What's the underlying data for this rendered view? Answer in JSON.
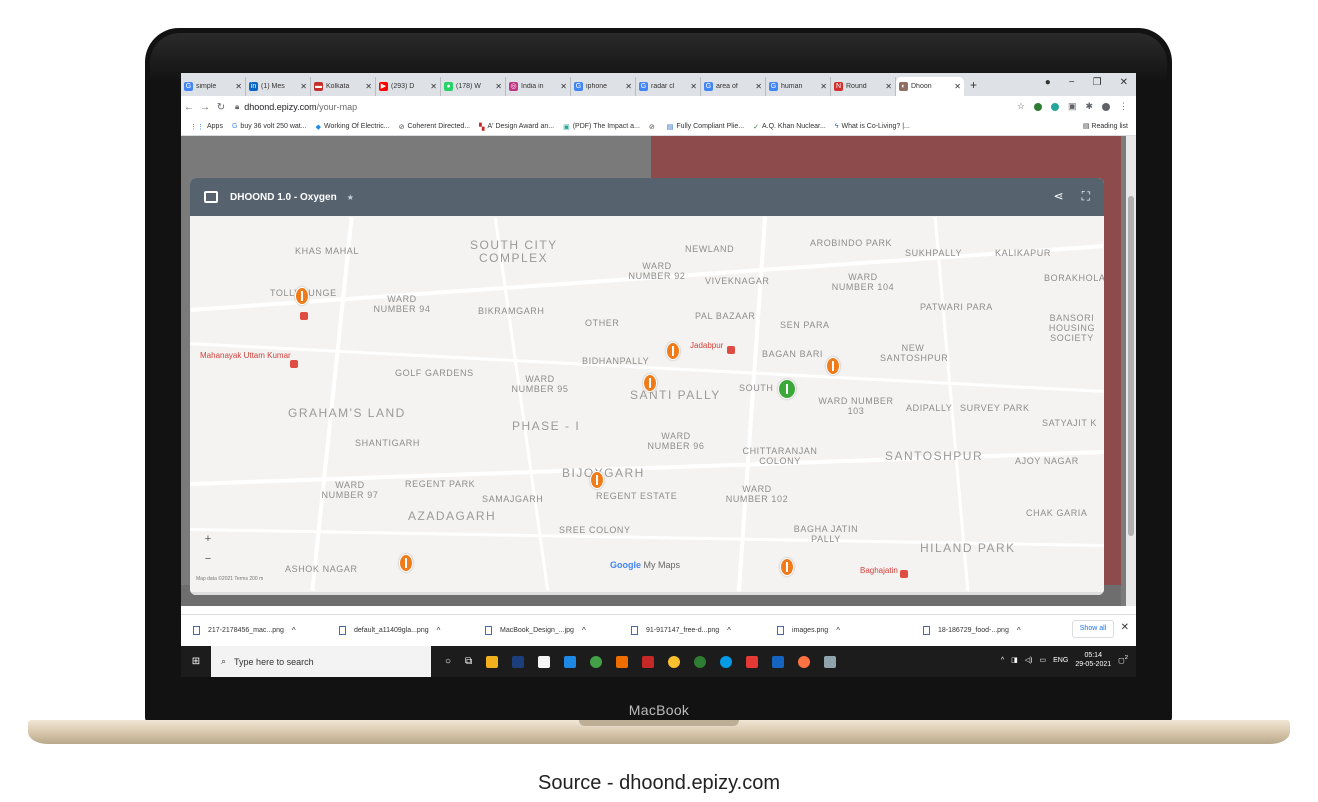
{
  "device_brand": "MacBook",
  "caption": "Source - dhoond.epizy.com",
  "browser": {
    "tabs": [
      {
        "label": "simple",
        "favicon_color": "#4285f4",
        "glyph": "G"
      },
      {
        "label": "(1) Mes",
        "favicon_color": "#0a66c2",
        "glyph": "in"
      },
      {
        "label": "Kolkata",
        "favicon_color": "#c4302b",
        "glyph": "▬"
      },
      {
        "label": "(293) D",
        "favicon_color": "#ff0000",
        "glyph": "▶"
      },
      {
        "label": "(178) W",
        "favicon_color": "#25d366",
        "glyph": "●"
      },
      {
        "label": "India in",
        "favicon_color": "#c13584",
        "glyph": "◎"
      },
      {
        "label": "iphone",
        "favicon_color": "#4285f4",
        "glyph": "G"
      },
      {
        "label": "radar cl",
        "favicon_color": "#4285f4",
        "glyph": "G"
      },
      {
        "label": "area of",
        "favicon_color": "#4285f4",
        "glyph": "G"
      },
      {
        "label": "human",
        "favicon_color": "#4285f4",
        "glyph": "G"
      },
      {
        "label": "Round",
        "favicon_color": "#d32f2f",
        "glyph": "N"
      },
      {
        "label": "Dhoon",
        "favicon_color": "#8d6e63",
        "glyph": "◐"
      }
    ],
    "url_host": "dhoond.epizy.com",
    "url_path": "/your-map",
    "bookmarks": [
      {
        "label": "Apps",
        "icon": "apps-grid"
      },
      {
        "label": "buy 36 volt 250 wat...",
        "icon": "google-icon"
      },
      {
        "label": "Working Of Electric...",
        "icon": "diamond-icon"
      },
      {
        "label": "Coherent Directed...",
        "icon": "globe-icon"
      },
      {
        "label": "A' Design Award an...",
        "icon": "award-icon"
      },
      {
        "label": "(PDF) The Impact a...",
        "icon": "pdf-icon"
      },
      {
        "label": "",
        "icon": "globe-icon"
      },
      {
        "label": "Fully Compliant Plie...",
        "icon": "page-icon"
      },
      {
        "label": "A.Q. Khan Nuclear...",
        "icon": "check-icon"
      },
      {
        "label": "What is Co-Living? |...",
        "icon": "bolt-icon"
      }
    ],
    "reading_list": "Reading list"
  },
  "map": {
    "title": "DHOOND 1.0 - Oxygen",
    "labels": [
      {
        "text": "SOUTH CITY",
        "size": "big"
      },
      {
        "text": "COMPLEX",
        "size": "big"
      },
      {
        "text": "NEWLAND"
      },
      {
        "text": "AROBINDO PARK"
      },
      {
        "text": "SUKHPALLY"
      },
      {
        "text": "KALIKAPUR"
      },
      {
        "text": "KHAS MAHAL"
      },
      {
        "text": "WARD NUMBER 92"
      },
      {
        "text": "VIVEKNAGAR"
      },
      {
        "text": "WARD NUMBER 104"
      },
      {
        "text": "BORAKHOLA"
      },
      {
        "text": "TOLLYGUNGE"
      },
      {
        "text": "WARD NUMBER 94"
      },
      {
        "text": "BIKRAMGARH"
      },
      {
        "text": "PAL BAZAAR"
      },
      {
        "text": "PATWARI PARA"
      },
      {
        "text": "OTHER"
      },
      {
        "text": "SEN PARA"
      },
      {
        "text": "BANSORI HOUSING SOCIETY"
      },
      {
        "text": "Jadabpur"
      },
      {
        "text": "BAGAN BARI"
      },
      {
        "text": "BIDHANPALLY"
      },
      {
        "text": "NEW SANTOSHPUR"
      },
      {
        "text": "Mahanayak Uttam Kumar",
        "size": "red"
      },
      {
        "text": "GOLF GARDENS"
      },
      {
        "text": "WARD NUMBER 95"
      },
      {
        "text": "SANTI PALLY",
        "size": "big"
      },
      {
        "text": "SOUTH"
      },
      {
        "text": "WARD NUMBER 103"
      },
      {
        "text": "ADIPALLY"
      },
      {
        "text": "SURVEY PARK"
      },
      {
        "text": "GRAHAM'S LAND",
        "size": "big"
      },
      {
        "text": "PHASE - I",
        "size": "big"
      },
      {
        "text": "SATYAJIT K"
      },
      {
        "text": "SHANTIGARH"
      },
      {
        "text": "WARD NUMBER 96"
      },
      {
        "text": "CHITTARANJAN COLONY"
      },
      {
        "text": "SANTOSHPUR",
        "size": "big"
      },
      {
        "text": "AJOY NAGAR"
      },
      {
        "text": "BIJOYGARH",
        "size": "big"
      },
      {
        "text": "REGENT PARK"
      },
      {
        "text": "WARD NUMBER 97"
      },
      {
        "text": "REGENT ESTATE"
      },
      {
        "text": "SAMAJGARH"
      },
      {
        "text": "WARD NUMBER 102"
      },
      {
        "text": "AZADAGARH",
        "size": "big"
      },
      {
        "text": "CHAK GARIA"
      },
      {
        "text": "SREE COLONY"
      },
      {
        "text": "BAGHA JATIN PALLY"
      },
      {
        "text": "HILAND PARK",
        "size": "big"
      },
      {
        "text": "ASHOK NAGAR"
      },
      {
        "text": "Baghajatin",
        "size": "red"
      }
    ],
    "google_brand": "Google",
    "my_maps": "My Maps",
    "map_data": "Map data ©2021",
    "terms": "Terms",
    "scale": "200 m",
    "zoom_in": "+",
    "zoom_out": "−"
  },
  "downloads": [
    {
      "name": "217-2178456_mac...png"
    },
    {
      "name": "default_a11409gla...png"
    },
    {
      "name": "MacBook_Design_...jpg"
    },
    {
      "name": "91-917147_free-d...png"
    },
    {
      "name": "images.png"
    },
    {
      "name": "18-186729_food-...png"
    }
  ],
  "show_all": "Show all",
  "taskbar": {
    "search_placeholder": "Type here to search",
    "lang": "ENG",
    "time": "05:14",
    "date": "29-05-2021",
    "notification_count": "2"
  }
}
